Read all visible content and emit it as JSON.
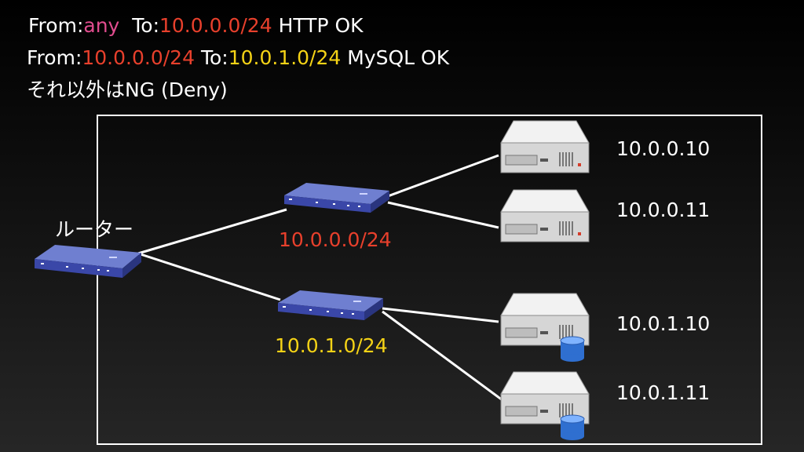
{
  "rules": [
    {
      "from_label": "From:",
      "from": "any",
      "to_label": "To:",
      "to": "10.0.0.0/24",
      "service": "HTTP OK"
    },
    {
      "from_label": "From:",
      "from": "10.0.0.0/24",
      "to_label": "To:",
      "to": "10.0.1.0/24",
      "service": "MySQL OK"
    }
  ],
  "default_rule": "それ以外はNG (Deny)",
  "router": {
    "label": "ルーター",
    "icon": "router-icon"
  },
  "subnets": [
    {
      "label": "10.0.0.0/24",
      "color": "#e8402c",
      "icon": "switch-icon"
    },
    {
      "label": "10.0.1.0/24",
      "color": "#f5d316",
      "icon": "switch-icon"
    }
  ],
  "servers": [
    {
      "ip": "10.0.0.10",
      "icon": "server-icon"
    },
    {
      "ip": "10.0.0.11",
      "icon": "server-icon"
    },
    {
      "ip": "10.0.1.10",
      "icon": "database-server-icon"
    },
    {
      "ip": "10.0.1.11",
      "icon": "database-server-icon"
    }
  ],
  "colors": {
    "any": "#e14d8f",
    "subnet0": "#e8402c",
    "subnet1": "#f5d316",
    "text": "#ffffff"
  }
}
